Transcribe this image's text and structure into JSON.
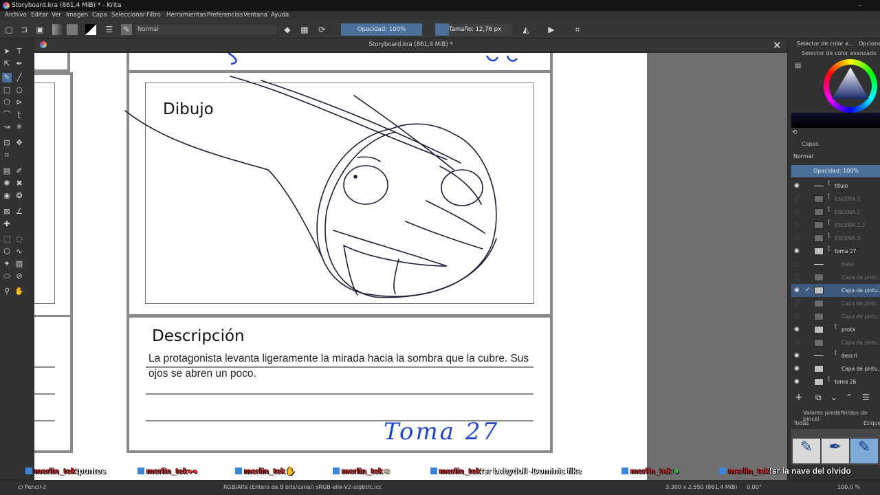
{
  "window": {
    "title": "Storyboard.kra (861,4 MiB) * - Krita",
    "minimize": "–"
  },
  "menu": [
    "Archivo",
    "Editar",
    "Ver",
    "Imagen",
    "Capa",
    "Seleccionar",
    "Filtro",
    "Herramientas",
    "Preferencias",
    "Ventana",
    "Ayuda"
  ],
  "toolbar": {
    "blend_mode": "Normal",
    "opacity": "Opacidad: 100%",
    "size": "Tamaño: 12,76 px"
  },
  "document_tab": {
    "title": "Storyboard.kra (861,4 MiB) *",
    "close": "✕"
  },
  "canvas": {
    "drawing_label": "Dibujo",
    "description_label": "Descripción",
    "description_text": "La protagonista levanta ligeramente la mirada hacia la sombra que la cubre. Sus ojos se abren un poco.",
    "shot_label": "Toma 27"
  },
  "right_dock": {
    "tab1": "Selector de color a...",
    "tab2": "Opcione",
    "color_section": "Selector de color avanzado",
    "layers_section": "Capas",
    "layers_blend": "Normal",
    "layers_opacity": "Opacidad:  100%",
    "layers": [
      {
        "name": "titulo",
        "visible": true
      },
      {
        "name": "ESCENA 1",
        "visible": false
      },
      {
        "name": "ESCENA 2",
        "visible": false
      },
      {
        "name": "ESCENA 2.2",
        "visible": false
      },
      {
        "name": "ESCENA 3",
        "visible": false
      },
      {
        "name": "toma 27",
        "visible": true
      },
      {
        "name": "base",
        "visible": false
      },
      {
        "name": "Capa de pintu...",
        "visible": false
      },
      {
        "name": "Capa de pintu...",
        "visible": true,
        "selected": true
      },
      {
        "name": "Capa de pintu...",
        "visible": false
      },
      {
        "name": "Capa de pintu...",
        "visible": false
      },
      {
        "name": "prota",
        "visible": true
      },
      {
        "name": "Capa de pintu...",
        "visible": false
      },
      {
        "name": "descri",
        "visible": true
      },
      {
        "name": "Capa de pintu...",
        "visible": true
      },
      {
        "name": "toma 26",
        "visible": true
      }
    ],
    "brush_presets_section": "Valores predefinidos de pincel",
    "brush_filter": "Todas",
    "brush_tag": "Etique"
  },
  "chat": [
    {
      "user": "merlin_tek",
      "msg": "!puntos"
    },
    {
      "user": "merlin_tek",
      "msg": ""
    },
    {
      "user": "merlin_tek",
      "msg": ""
    },
    {
      "user": "merlin_tek",
      "msg": ""
    },
    {
      "user": "merlin_tek",
      "msg": "!sr babydoll -Dominic fike"
    },
    {
      "user": "merlin_tek",
      "msg": ""
    },
    {
      "user": "merlin_tek",
      "msg": "!sr la nave del olvido"
    }
  ],
  "status": {
    "brush": "c) Pencil-2",
    "color_space": "RGB/Alfa (Entero de 8 bits/canal)  sRGB-elle-V2-srgbtrc.icc",
    "dimensions": "3.300 x 2.550 (861,4 MiB)",
    "rotation": "0,00°",
    "zoom": "100,0 %"
  },
  "colors": {
    "accent": "#4a6f99",
    "selected_layer": "#3d5a7e",
    "chat_user": "#d23232",
    "ink_blue": "#2244cc"
  }
}
